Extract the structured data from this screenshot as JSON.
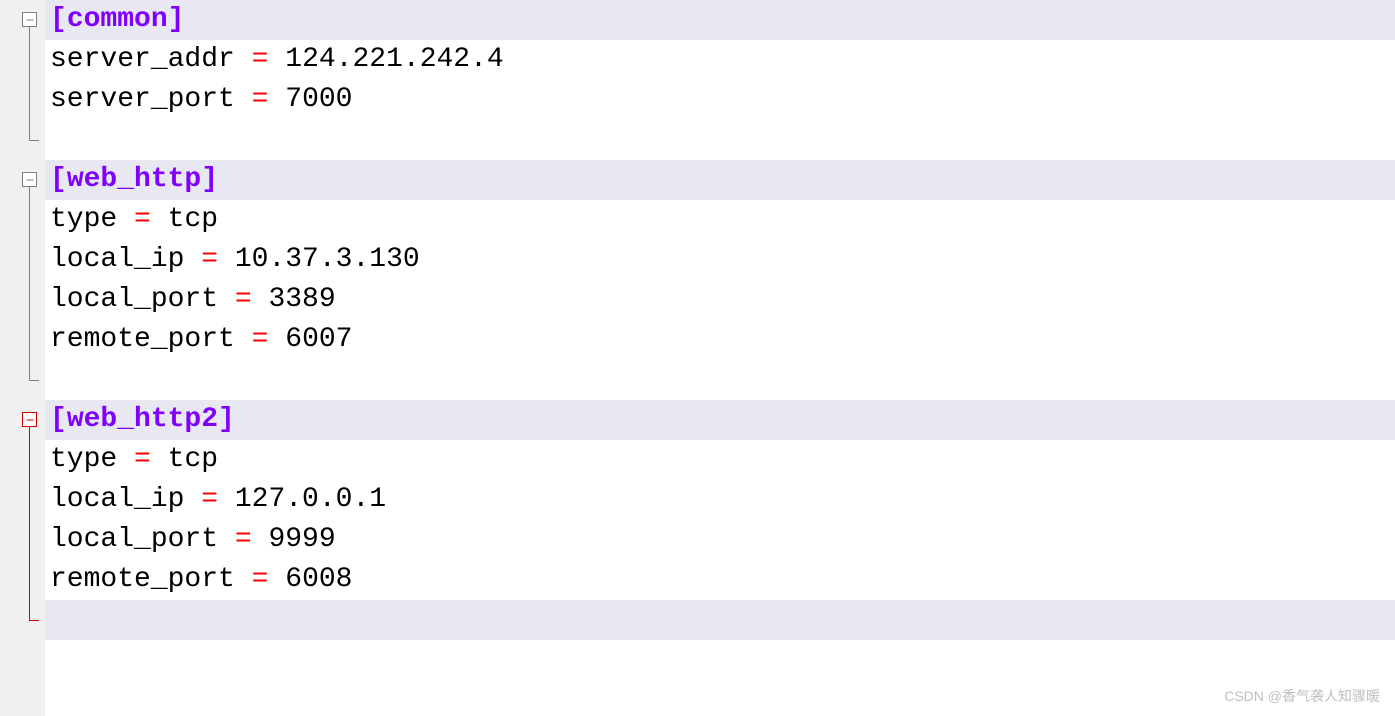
{
  "sections": [
    {
      "header": {
        "open": "[",
        "name": "common",
        "close": "]"
      },
      "entries": [
        {
          "key": "server_addr",
          "eq": " = ",
          "value": "124.221.242.4"
        },
        {
          "key": "server_port",
          "eq": " = ",
          "value": "7000"
        }
      ],
      "fold_color": "gray"
    },
    {
      "header": {
        "open": "[",
        "name": "web_http",
        "close": "]"
      },
      "entries": [
        {
          "key": "type",
          "eq": " = ",
          "value": "tcp"
        },
        {
          "key": "local_ip",
          "eq": " = ",
          "value": "10.37.3.130"
        },
        {
          "key": "local_port",
          "eq": " = ",
          "value": "3389"
        },
        {
          "key": "remote_port",
          "eq": " = ",
          "value": "6007"
        }
      ],
      "fold_color": "gray"
    },
    {
      "header": {
        "open": "[",
        "name": "web_http2",
        "close": "]"
      },
      "entries": [
        {
          "key": "type",
          "eq": " = ",
          "value": "tcp"
        },
        {
          "key": "local_ip",
          "eq": " = ",
          "value": "127.0.0.1"
        },
        {
          "key": "local_port",
          "eq": " = ",
          "value": "9999"
        },
        {
          "key": "remote_port",
          "eq": " = ",
          "value": "6008"
        }
      ],
      "fold_color": "red"
    }
  ],
  "watermark": "CSDN @香气袭人知骤暖"
}
